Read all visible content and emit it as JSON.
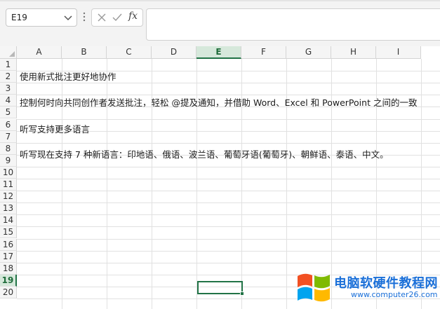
{
  "name_box": {
    "value": "E19"
  },
  "formula_bar": {
    "fx_label": "fx",
    "value": ""
  },
  "columns": [
    "A",
    "B",
    "C",
    "D",
    "E",
    "F",
    "G",
    "H",
    "I"
  ],
  "active_column": "E",
  "rows": [
    "1",
    "2",
    "3",
    "4",
    "5",
    "6",
    "7",
    "8",
    "9",
    "10",
    "11",
    "12",
    "13",
    "14",
    "15",
    "16",
    "17",
    "18",
    "19",
    "20"
  ],
  "active_row": "19",
  "cells": {
    "A2": "使用新式批注更好地协作",
    "A4": "控制何时向共同创作者发送批注，轻松 @提及通知，并借助 Word、Excel 和 PowerPoint 之间的一致",
    "A6": "听写支持更多语言",
    "A8": "听写现在支持 7 种新语言：印地语、俄语、波兰语、葡萄牙语(葡萄牙)、朝鲜语、泰语、中文。"
  },
  "watermark": {
    "title": "电脑软硬件教程网",
    "url": "www.computer26.com"
  },
  "colors": {
    "accent": "#217346",
    "header_bg": "#f5f5f5",
    "watermark_blue": "#1a6fd8"
  }
}
